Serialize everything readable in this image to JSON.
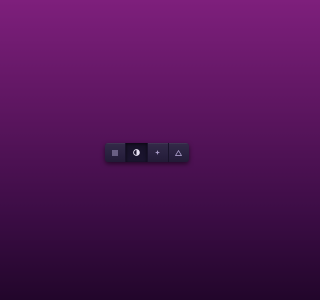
{
  "toolbar": {
    "buttons": [
      {
        "icon": "menu-icon",
        "active": false
      },
      {
        "icon": "theme-toggle-icon",
        "active": true
      },
      {
        "icon": "sparkle-icon",
        "active": false
      },
      {
        "icon": "warning-triangle-icon",
        "active": false
      }
    ],
    "colors": {
      "icon": "#a99cc8",
      "icon_active": "#e8e2f4",
      "button": "#2a2240",
      "button_active": "#1a1430"
    }
  }
}
